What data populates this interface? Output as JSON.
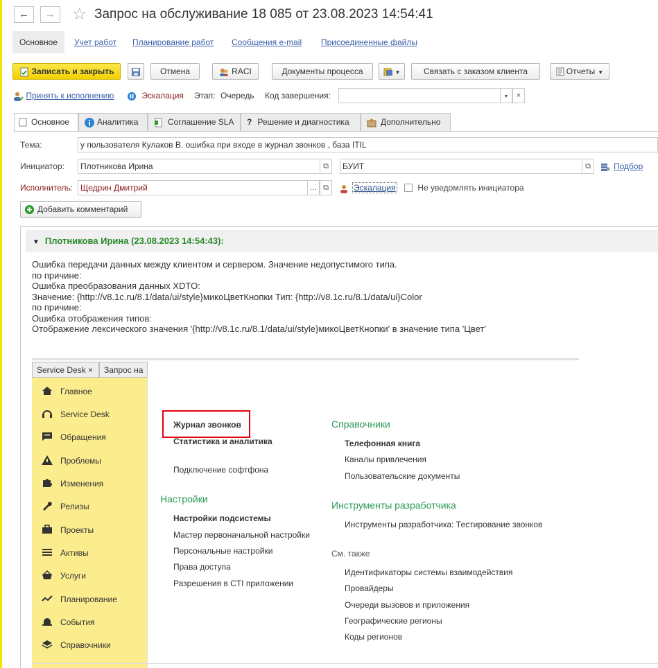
{
  "window": {
    "title": "Запрос на обслуживание 18 085 от 23.08.2023 14:54:41",
    "back_icon": "arrow-left-icon",
    "forward_icon": "arrow-right-icon",
    "favorite_icon": "star-icon"
  },
  "sections": [
    {
      "label": "Основное",
      "active": true
    },
    {
      "label": "Учет работ"
    },
    {
      "label": "Планирование работ"
    },
    {
      "label": "Сообщения e-mail"
    },
    {
      "label": "Присоединенные файлы"
    }
  ],
  "toolbar": {
    "save_close": "Записать и закрыть",
    "cancel": "Отмена",
    "raci": "RACI",
    "process_docs": "Документы процесса",
    "link_order": "Связать с заказом клиента",
    "reports": "Отчеты"
  },
  "status": {
    "accept": "Принять к исполнению",
    "escalation": "Эскалация",
    "stage_label": "Этап:",
    "stage_value": "Очередь",
    "completion_code_label": "Код завершения:",
    "completion_code_value": ""
  },
  "tabs": [
    {
      "label": "Основное",
      "icon": "document-icon"
    },
    {
      "label": "Аналитика",
      "icon": "info-icon"
    },
    {
      "label": "Соглашение SLA",
      "icon": "agreement-icon"
    },
    {
      "label": "Решение и диагностика",
      "icon": "question-icon"
    },
    {
      "label": "Дополнительно",
      "icon": "box-icon"
    }
  ],
  "form": {
    "topic_label": "Тема:",
    "topic_value": "у пользователя Кулаков В. ошибка при входе в журнал звонков , база ITIL",
    "initiator_label": "Инициатор:",
    "initiator_value": "Плотникова Ирина",
    "department_value": "БУИТ",
    "selection_link": "Подбор",
    "executor_label": "Исполнитель:",
    "executor_value": "Щедрин Дмитрий",
    "escalation_link": "Эскалация",
    "no_notify_label": "Не уведомлять инициатора",
    "add_comment": "Добавить комментарий"
  },
  "comment": {
    "header": "Плотникова Ирина (23.08.2023 14:54:43):",
    "lines": [
      "Ошибка передачи данных между клиентом и сервером. Значение недопустимого типа.",
      "по причине:",
      "Ошибка преобразования данных XDTO:",
      "Значение: {http://v8.1c.ru/8.1/data/ui/style}микоЦветКнопки Тип: {http://v8.1c.ru/8.1/data/ui}Color",
      "по причине:",
      "Ошибка отображения типов:",
      "Отображение лексического значения '{http://v8.1c.ru/8.1/data/ui/style}микоЦветКнопки' в значение типа 'Цвет'"
    ]
  },
  "embedded": {
    "tab1": "Service Desk ×",
    "tab2": "Запрос на",
    "sidebar": [
      {
        "label": "Главное",
        "icon": "home-icon"
      },
      {
        "label": "Service Desk",
        "icon": "headset-icon"
      },
      {
        "label": "Обращения",
        "icon": "chat-icon"
      },
      {
        "label": "Проблемы",
        "icon": "warning-icon"
      },
      {
        "label": "Изменения",
        "icon": "puzzle-icon"
      },
      {
        "label": "Релизы",
        "icon": "wrench-icon"
      },
      {
        "label": "Проекты",
        "icon": "briefcase-icon"
      },
      {
        "label": "Активы",
        "icon": "list-icon"
      },
      {
        "label": "Услуги",
        "icon": "basket-icon"
      },
      {
        "label": "Планирование",
        "icon": "chart-icon"
      },
      {
        "label": "События",
        "icon": "bell-icon"
      },
      {
        "label": "Справочники",
        "icon": "layers-icon"
      }
    ],
    "col1_items": [
      {
        "label": "Журнал звонков",
        "bold": true
      },
      {
        "label": "Статистика и аналитика",
        "bold": true
      },
      {
        "label": "Подключение софтфона",
        "bold": false
      }
    ],
    "settings_head": "Настройки",
    "settings_items": [
      {
        "label": "Настройки подсистемы",
        "bold": true
      },
      {
        "label": "Мастер первоначальной настройки",
        "bold": false
      },
      {
        "label": "Персональные настройки",
        "bold": false
      },
      {
        "label": "Права доступа",
        "bold": false
      },
      {
        "label": "Разрешения в CTI приложении",
        "bold": false
      }
    ],
    "refs_head": "Справочники",
    "refs_items": [
      {
        "label": "Телефонная книга",
        "bold": true
      },
      {
        "label": "Каналы привлечения",
        "bold": false
      },
      {
        "label": "Пользовательские документы",
        "bold": false
      }
    ],
    "devtools_head": "Инструменты разработчика",
    "devtools_items": [
      {
        "label": "Инструменты разработчика: Тестирование звонков",
        "bold": false
      }
    ],
    "see_also_head": "См. также",
    "see_also_items": [
      {
        "label": "Идентификаторы системы взаимодействия"
      },
      {
        "label": "Провайдеры"
      },
      {
        "label": "Очереди вызовов и приложения"
      },
      {
        "label": "Географические регионы"
      },
      {
        "label": "Коды регионов"
      }
    ]
  },
  "colors": {
    "accent_yellow": "#f2d200",
    "link_blue": "#3a5faa",
    "green_heading": "#2a9a55",
    "highlight_red": "#e3000f",
    "escalation_text": "#8a1c1c"
  }
}
